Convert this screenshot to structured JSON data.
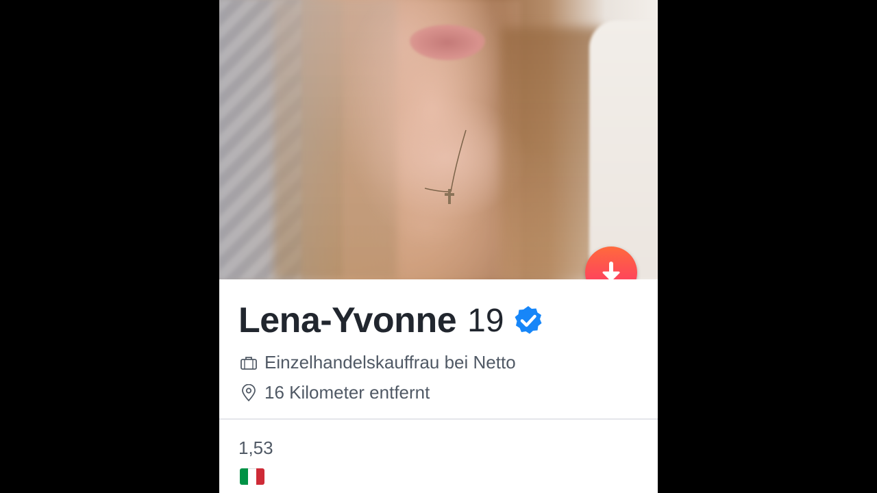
{
  "profile": {
    "name": "Lena-Yvonne",
    "age": "19",
    "verified": true,
    "job": "Einzelhandelskauffrau bei Netto",
    "distance": "16 Kilometer entfernt",
    "bio_line": "1,53",
    "flag_country": "Italy",
    "flag_colors": [
      "#009246",
      "#ffffff",
      "#ce2b37"
    ]
  },
  "icons": {
    "collapse_button": "arrow-down-icon",
    "verified": "verified-badge-icon",
    "job": "briefcase-icon",
    "distance": "location-pin-icon"
  },
  "colors": {
    "accent_gradient_start": "#ff6a3d",
    "accent_gradient_end": "#fd2f6c",
    "verified_blue": "#1786f8",
    "name_text": "#21262e",
    "detail_text": "#505965"
  }
}
